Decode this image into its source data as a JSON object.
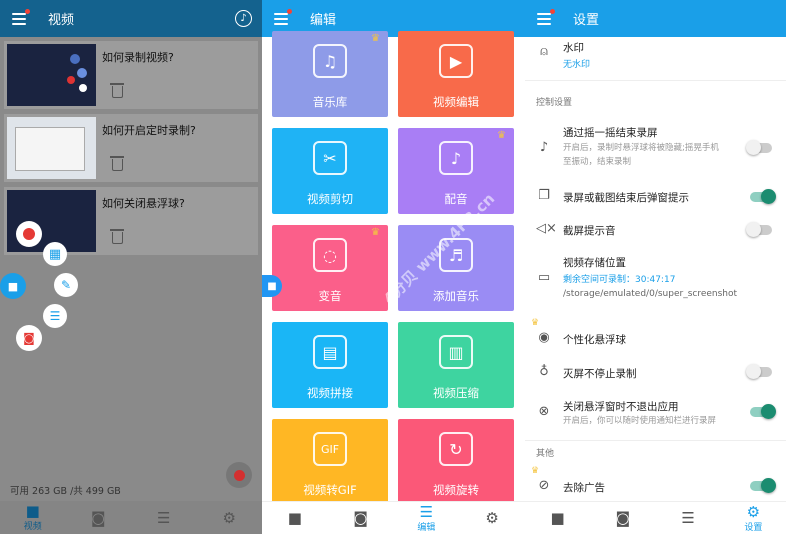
{
  "left_panel": {
    "title": "视频",
    "tutorials": [
      {
        "title": "如何录制视频?"
      },
      {
        "title": "如何开启定时录制?"
      },
      {
        "title": "如何关闭悬浮球?"
      }
    ],
    "storage": "可用 263 GB /共 499 GB",
    "nav": [
      {
        "label": "视频",
        "icon": "camcorder-icon"
      },
      {
        "label": "",
        "icon": "camera-icon"
      },
      {
        "label": "",
        "icon": "sliders-icon"
      },
      {
        "label": "",
        "icon": "gear-icon"
      }
    ]
  },
  "middle_panel": {
    "title": "编辑",
    "tiles": [
      {
        "label": "音乐库",
        "icon": "music-note-icon",
        "color": "#8e9be8",
        "crown": true
      },
      {
        "label": "视频编辑",
        "icon": "video-edit-icon",
        "color": "#f86a4a",
        "crown": false
      },
      {
        "label": "视频剪切",
        "icon": "video-cut-icon",
        "color": "#1fb3f5",
        "crown": false
      },
      {
        "label": "配音",
        "icon": "dubbing-icon",
        "color": "#a97ef5",
        "crown": true
      },
      {
        "label": "变音",
        "icon": "voice-change-icon",
        "color": "#fb5f8a",
        "crown": true
      },
      {
        "label": "添加音乐",
        "icon": "add-music-icon",
        "color": "#9a8cf4",
        "crown": false
      },
      {
        "label": "视频拼接",
        "icon": "video-join-icon",
        "color": "#1ab6f6",
        "crown": false
      },
      {
        "label": "视频压缩",
        "icon": "video-compress-icon",
        "color": "#3ed4a0",
        "crown": false
      },
      {
        "label": "视频转GIF",
        "icon": "gif-icon",
        "color": "#ffb724",
        "crown": false
      },
      {
        "label": "视频旋转",
        "icon": "video-rotate-icon",
        "color": "#fb5878",
        "crown": false
      }
    ],
    "nav": [
      {
        "label": "",
        "icon": "camcorder-icon"
      },
      {
        "label": "",
        "icon": "camera-icon"
      },
      {
        "label": "编辑",
        "icon": "sliders-icon"
      },
      {
        "label": "",
        "icon": "gear-icon"
      }
    ]
  },
  "right_panel": {
    "title": "设置",
    "watermark": {
      "title": "水印",
      "value": "无水印"
    },
    "control_section": "控制设置",
    "shake": {
      "title": "通过摇一摇结束录屏",
      "desc1": "开启后，录制时悬浮球将被隐藏;摇晃手机",
      "desc2": "至振动，结束录制",
      "on": false
    },
    "popup": {
      "title": "录屏或截图结束后弹窗提示",
      "on": true
    },
    "sound": {
      "title": "截屏提示音",
      "on": false
    },
    "storage_loc": {
      "title": "视频存储位置",
      "remaining": "剩余空间可录制：30:47:17",
      "path": "/storage/emulated/0/super_screenshot"
    },
    "float_ball": {
      "title": "个性化悬浮球"
    },
    "screen_off": {
      "title": "灭屏不停止录制",
      "on": false
    },
    "no_exit": {
      "title": "关闭悬浮窗时不退出应用",
      "desc": "开启后，你可以随时使用通知栏进行录屏",
      "on": true
    },
    "other_section": "其他",
    "remove_ads": {
      "title": "去除广告",
      "on": true
    },
    "nav": [
      {
        "label": "",
        "icon": "camcorder-icon"
      },
      {
        "label": "",
        "icon": "camera-icon"
      },
      {
        "label": "",
        "icon": "sliders-icon"
      },
      {
        "label": "设置",
        "icon": "gear-icon"
      }
    ]
  },
  "overlay_watermark": "4分贝 www.4FB.cn",
  "colors": {
    "accent": "#1a9fe8",
    "toggle_on": "#1b8c70",
    "record_red": "#e53935"
  }
}
